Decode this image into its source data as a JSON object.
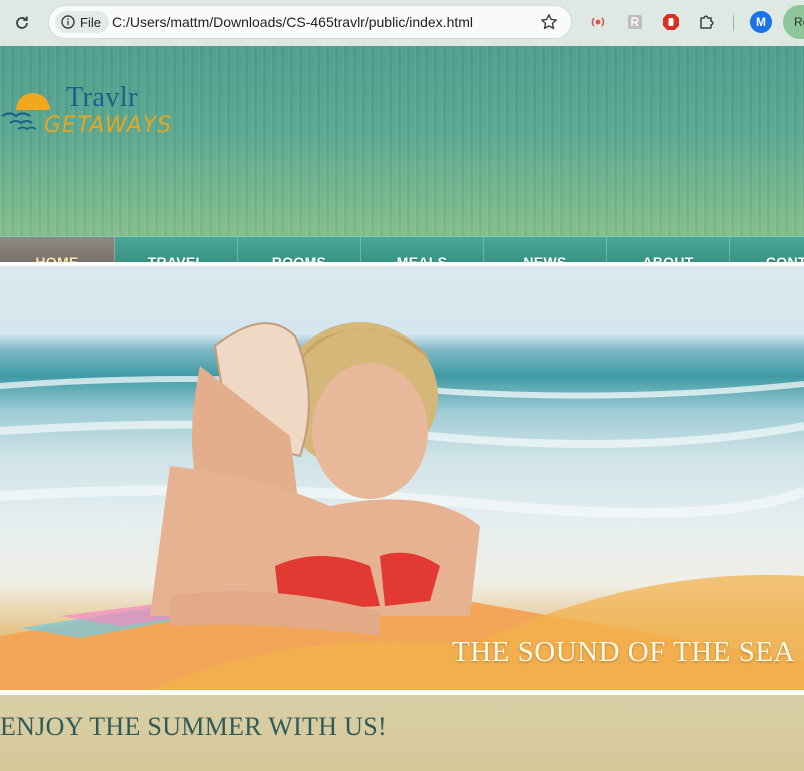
{
  "browser": {
    "site_info_label": "File",
    "url": "C:/Users/mattm/Downloads/CS-465travlr/public/index.html",
    "profile_initial": "M",
    "profile_label": "Re"
  },
  "logo": {
    "line1": "Travlr",
    "line2": "GETAWAYS"
  },
  "nav": {
    "items": [
      "HOME",
      "TRAVEL",
      "ROOMS",
      "MEALS",
      "NEWS",
      "ABOUT",
      "CONTA"
    ],
    "active": "HOME"
  },
  "hero": {
    "caption": "THE SOUND OF THE SEA"
  },
  "content": {
    "heading": "ENJOY THE SUMMER WITH US!"
  },
  "colors": {
    "nav_teal": "#3a9585",
    "nav_active": "#777068",
    "heading": "#2f5b5a",
    "logo_blue": "#1e5f8a",
    "logo_orange": "#e6a623"
  }
}
